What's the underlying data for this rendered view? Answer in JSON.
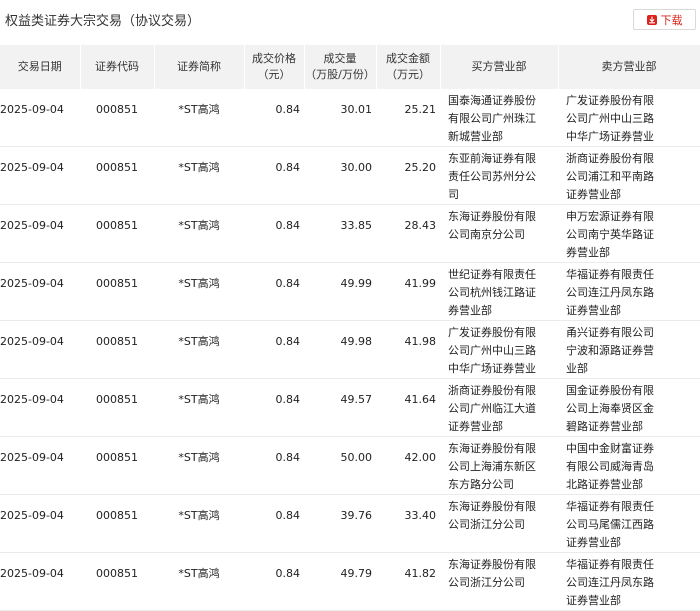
{
  "header": {
    "title": "权益类证券大宗交易（协议交易）",
    "download_label": "下载"
  },
  "table": {
    "columns": [
      "交易日期",
      "证券代码",
      "证券简称",
      "成交价格\n（元）",
      "成交量\n（万股/万份）",
      "成交金额\n（万元）",
      "买方营业部",
      "卖方营业部"
    ],
    "rows": [
      {
        "date": "2025-09-04",
        "code": "000851",
        "name": "*ST高鸿",
        "price": "0.84",
        "volume": "30.01",
        "amount": "25.21",
        "buyer": "国泰海通证券股份有限公司广州珠江新城营业部",
        "seller": "广发证券股份有限公司广州中山三路中华广场证券营业部"
      },
      {
        "date": "2025-09-04",
        "code": "000851",
        "name": "*ST高鸿",
        "price": "0.84",
        "volume": "30.00",
        "amount": "25.20",
        "buyer": "东亚前海证券有限责任公司苏州分公司",
        "seller": "浙商证券股份有限公司浦江和平南路证券营业部"
      },
      {
        "date": "2025-09-04",
        "code": "000851",
        "name": "*ST高鸿",
        "price": "0.84",
        "volume": "33.85",
        "amount": "28.43",
        "buyer": "东海证券股份有限公司南京分公司",
        "seller": "申万宏源证券有限公司南宁英华路证券营业部"
      },
      {
        "date": "2025-09-04",
        "code": "000851",
        "name": "*ST高鸿",
        "price": "0.84",
        "volume": "49.99",
        "amount": "41.99",
        "buyer": "世纪证券有限责任公司杭州钱江路证券营业部",
        "seller": "华福证券有限责任公司连江丹凤东路证券营业部"
      },
      {
        "date": "2025-09-04",
        "code": "000851",
        "name": "*ST高鸿",
        "price": "0.84",
        "volume": "49.98",
        "amount": "41.98",
        "buyer": "广发证券股份有限公司广州中山三路中华广场证券营业部",
        "seller": "甬兴证券有限公司宁波和源路证券营业部"
      },
      {
        "date": "2025-09-04",
        "code": "000851",
        "name": "*ST高鸿",
        "price": "0.84",
        "volume": "49.57",
        "amount": "41.64",
        "buyer": "浙商证券股份有限公司广州临江大道证券营业部",
        "seller": "国金证券股份有限公司上海奉贤区金碧路证券营业部"
      },
      {
        "date": "2025-09-04",
        "code": "000851",
        "name": "*ST高鸿",
        "price": "0.84",
        "volume": "50.00",
        "amount": "42.00",
        "buyer": "东海证券股份有限公司上海浦东新区东方路分公司",
        "seller": "中国中金财富证券有限公司威海青岛北路证券营业部"
      },
      {
        "date": "2025-09-04",
        "code": "000851",
        "name": "*ST高鸿",
        "price": "0.84",
        "volume": "39.76",
        "amount": "33.40",
        "buyer": "东海证券股份有限公司浙江分公司",
        "seller": "华福证券有限责任公司马尾儒江西路证券营业部"
      },
      {
        "date": "2025-09-04",
        "code": "000851",
        "name": "*ST高鸿",
        "price": "0.84",
        "volume": "49.79",
        "amount": "41.82",
        "buyer": "东海证券股份有限公司浙江分公司",
        "seller": "华福证券有限责任公司连江丹凤东路证券营业部"
      }
    ]
  }
}
